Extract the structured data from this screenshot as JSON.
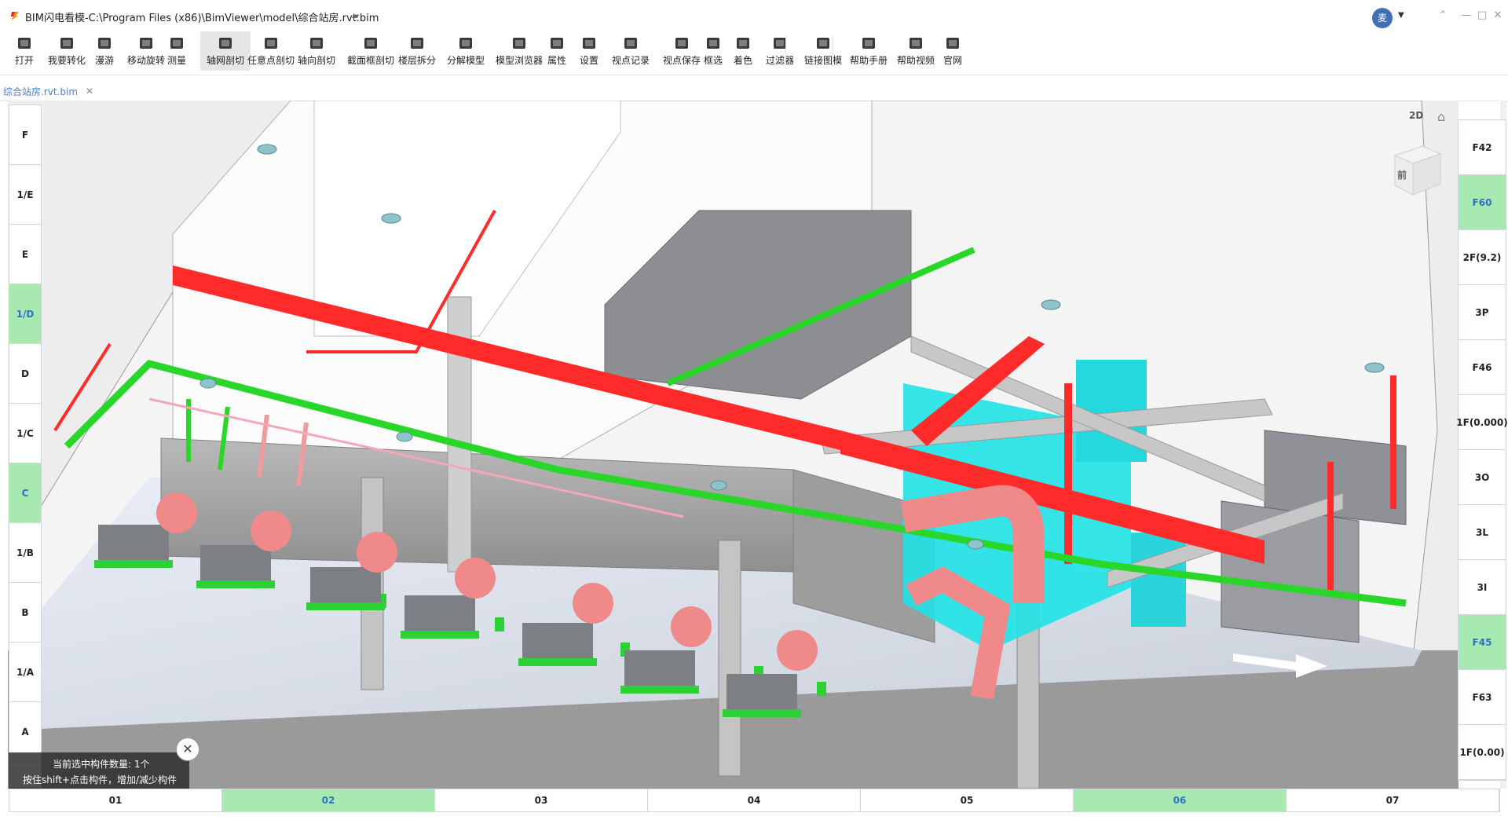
{
  "window": {
    "title": "BIM闪电看模-C:\\Program Files (x86)\\BimViewer\\model\\综合站房.rvt.bim",
    "avatar_text": "麦",
    "minimize": "—",
    "restore": "□",
    "close": "✕"
  },
  "toolbar": {
    "items": [
      {
        "label": "打开",
        "icon": "folder-open-icon"
      },
      {
        "label": "我要转化",
        "icon": "convert-icon"
      },
      {
        "label": "漫游",
        "icon": "walk-icon"
      },
      {
        "label": "移动旋转",
        "icon": "rotate-icon"
      },
      {
        "label": "测量",
        "icon": "ruler-icon"
      },
      {
        "label": "轴网剖切",
        "icon": "grid-section-icon",
        "active": true
      },
      {
        "label": "任意点剖切",
        "icon": "point-section-icon"
      },
      {
        "label": "轴向剖切",
        "icon": "axis-section-icon"
      },
      {
        "label": "截面框剖切",
        "icon": "box-section-icon"
      },
      {
        "label": "楼层拆分",
        "icon": "layers-icon"
      },
      {
        "label": "分解模型",
        "icon": "explode-icon"
      },
      {
        "label": "模型浏览器",
        "icon": "tree-icon"
      },
      {
        "label": "属性",
        "icon": "info-icon"
      },
      {
        "label": "设置",
        "icon": "gear-icon"
      },
      {
        "label": "视点记录",
        "icon": "viewpoint-record-icon"
      },
      {
        "label": "视点保存",
        "icon": "viewpoint-save-icon"
      },
      {
        "label": "框选",
        "icon": "box-select-icon"
      },
      {
        "label": "着色",
        "icon": "paint-bucket-icon"
      },
      {
        "label": "过滤器",
        "icon": "filter-icon"
      },
      {
        "label": "链接图模",
        "icon": "link-icon"
      },
      {
        "label": "帮助手册",
        "icon": "manual-icon"
      },
      {
        "label": "帮助视频",
        "icon": "video-icon"
      },
      {
        "label": "官网",
        "icon": "home-icon"
      }
    ]
  },
  "tab": {
    "label": "综合站房.rvt.bim",
    "close": "✕"
  },
  "axes": {
    "left": [
      {
        "label": "F",
        "on": false
      },
      {
        "label": "1/E",
        "on": false
      },
      {
        "label": "E",
        "on": false
      },
      {
        "label": "1/D",
        "on": true
      },
      {
        "label": "D",
        "on": false
      },
      {
        "label": "1/C",
        "on": false
      },
      {
        "label": "C",
        "on": true
      },
      {
        "label": "1/B",
        "on": false
      },
      {
        "label": "B",
        "on": false
      },
      {
        "label": "1/A",
        "on": false
      },
      {
        "label": "A",
        "on": false
      }
    ],
    "right": [
      {
        "label": "F42",
        "on": false
      },
      {
        "label": "F60",
        "on": true
      },
      {
        "label": "2F(9.2)",
        "on": false
      },
      {
        "label": "3P",
        "on": false
      },
      {
        "label": "F46",
        "on": false
      },
      {
        "label": "1F(0.000)",
        "on": false
      },
      {
        "label": "3O",
        "on": false
      },
      {
        "label": "3L",
        "on": false
      },
      {
        "label": "3I",
        "on": false
      },
      {
        "label": "F45",
        "on": true
      },
      {
        "label": "F63",
        "on": false
      },
      {
        "label": "1F(0.00)",
        "on": false
      }
    ],
    "bottom": [
      {
        "label": "01",
        "on": false
      },
      {
        "label": "02",
        "on": true
      },
      {
        "label": "03",
        "on": false
      },
      {
        "label": "04",
        "on": false
      },
      {
        "label": "05",
        "on": false
      },
      {
        "label": "06",
        "on": true
      },
      {
        "label": "07",
        "on": false
      }
    ]
  },
  "status": {
    "line1": "当前选中构件数量: 1个",
    "line2": "按住shift+点击构件，增加/减少构件",
    "close": "✕"
  },
  "viewer": {
    "btn_2d": "2D",
    "cube_label": "前",
    "colors": {
      "fire_pipe": "#ff2a2a",
      "water_pipe": "#2bd62b",
      "cyan_equipment": "#19e6e6",
      "pump": "#f08a8a",
      "selection": "#a7e9b0",
      "link": "#2e72c5"
    }
  }
}
